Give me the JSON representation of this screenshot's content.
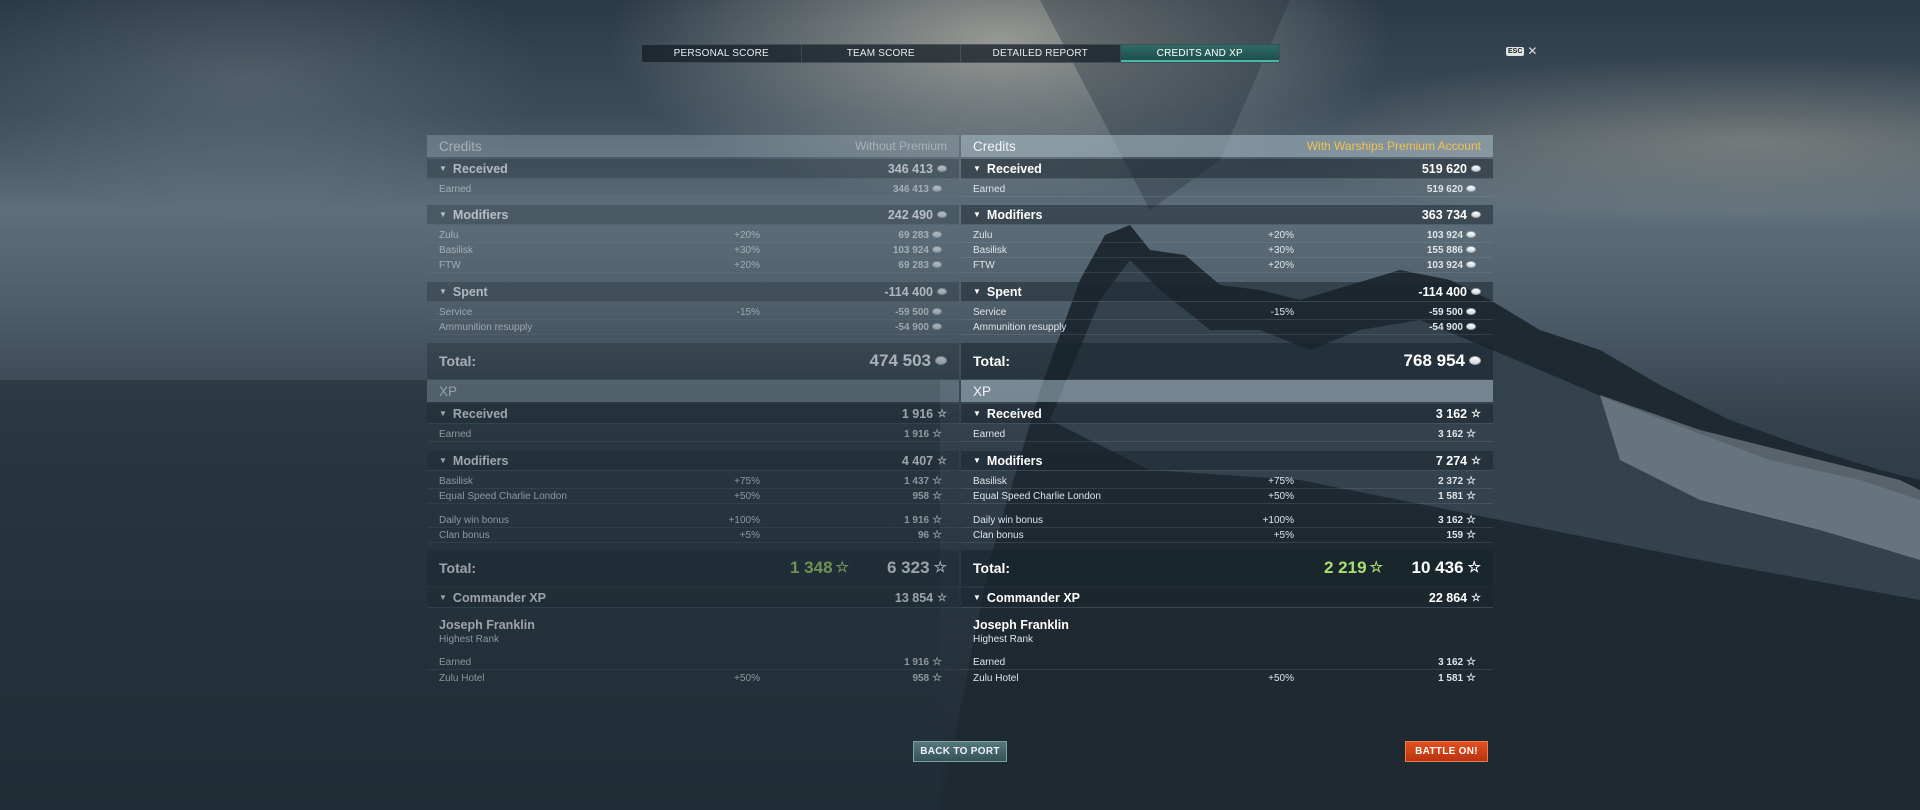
{
  "tabs": [
    {
      "label": "PERSONAL SCORE",
      "active": false
    },
    {
      "label": "TEAM SCORE",
      "active": false
    },
    {
      "label": "DETAILED REPORT",
      "active": false
    },
    {
      "label": "CREDITS AND XP",
      "active": true
    }
  ],
  "esc_label": "ESC",
  "colors": {
    "premium_accent": "#f2c24d",
    "active_tab": "#2f6a67",
    "xp_green": "#a9e06c",
    "battle_button": "#d0431a"
  },
  "left": {
    "credits_title": "Credits",
    "column_title": "Without Premium",
    "credits": {
      "received": {
        "label": "Received",
        "value": "346 413",
        "rows": [
          {
            "label": "Earned",
            "pct": "",
            "value": "346 413"
          }
        ]
      },
      "modifiers": {
        "label": "Modifiers",
        "value": "242 490",
        "rows": [
          {
            "label": "Zulu",
            "pct": "+20%",
            "value": "69 283"
          },
          {
            "label": "Basilisk",
            "pct": "+30%",
            "value": "103 924"
          },
          {
            "label": "FTW",
            "pct": "+20%",
            "value": "69 283"
          }
        ]
      },
      "spent": {
        "label": "Spent",
        "value": "-114 400",
        "rows": [
          {
            "label": "Service",
            "pct": "-15%",
            "value": "-59 500"
          },
          {
            "label": "Ammunition resupply",
            "pct": "",
            "value": "-54 900"
          }
        ]
      },
      "total_label": "Total:",
      "total": "474 503"
    },
    "xp_title": "XP",
    "xp": {
      "received": {
        "label": "Received",
        "value": "1 916",
        "rows": [
          {
            "label": "Earned",
            "pct": "",
            "value": "1 916"
          }
        ]
      },
      "modifiers": {
        "label": "Modifiers",
        "value": "4 407",
        "rows": [
          {
            "label": "Basilisk",
            "pct": "+75%",
            "value": "1 437"
          },
          {
            "label": "Equal Speed Charlie London",
            "pct": "+50%",
            "value": "958"
          },
          {
            "label": "Daily win bonus",
            "pct": "+100%",
            "value": "1 916"
          },
          {
            "label": "Clan bonus",
            "pct": "+5%",
            "value": "96"
          }
        ]
      },
      "total_label": "Total:",
      "total_free": "1 348",
      "total": "6 323"
    },
    "commander": {
      "label": "Commander XP",
      "value": "13 854",
      "name": "Joseph Franklin",
      "rank": "Highest Rank",
      "rows": [
        {
          "label": "Earned",
          "pct": "",
          "value": "1 916"
        },
        {
          "label": "Zulu Hotel",
          "pct": "+50%",
          "value": "958"
        }
      ]
    }
  },
  "right": {
    "credits_title": "Credits",
    "column_title": "With Warships Premium Account",
    "credits": {
      "received": {
        "label": "Received",
        "value": "519 620",
        "rows": [
          {
            "label": "Earned",
            "pct": "",
            "value": "519 620"
          }
        ]
      },
      "modifiers": {
        "label": "Modifiers",
        "value": "363 734",
        "rows": [
          {
            "label": "Zulu",
            "pct": "+20%",
            "value": "103 924"
          },
          {
            "label": "Basilisk",
            "pct": "+30%",
            "value": "155 886"
          },
          {
            "label": "FTW",
            "pct": "+20%",
            "value": "103 924"
          }
        ]
      },
      "spent": {
        "label": "Spent",
        "value": "-114 400",
        "rows": [
          {
            "label": "Service",
            "pct": "-15%",
            "value": "-59 500"
          },
          {
            "label": "Ammunition resupply",
            "pct": "",
            "value": "-54 900"
          }
        ]
      },
      "total_label": "Total:",
      "total": "768 954"
    },
    "xp_title": "XP",
    "xp": {
      "received": {
        "label": "Received",
        "value": "3 162",
        "rows": [
          {
            "label": "Earned",
            "pct": "",
            "value": "3 162"
          }
        ]
      },
      "modifiers": {
        "label": "Modifiers",
        "value": "7 274",
        "rows": [
          {
            "label": "Basilisk",
            "pct": "+75%",
            "value": "2 372"
          },
          {
            "label": "Equal Speed Charlie London",
            "pct": "+50%",
            "value": "1 581"
          },
          {
            "label": "Daily win bonus",
            "pct": "+100%",
            "value": "3 162"
          },
          {
            "label": "Clan bonus",
            "pct": "+5%",
            "value": "159"
          }
        ]
      },
      "total_label": "Total:",
      "total_free": "2 219",
      "total": "10 436"
    },
    "commander": {
      "label": "Commander XP",
      "value": "22 864",
      "name": "Joseph Franklin",
      "rank": "Highest Rank",
      "rows": [
        {
          "label": "Earned",
          "pct": "",
          "value": "3 162"
        },
        {
          "label": "Zulu Hotel",
          "pct": "+50%",
          "value": "1 581"
        }
      ]
    }
  },
  "buttons": {
    "back": "BACK TO PORT",
    "battle": "BATTLE ON!"
  }
}
